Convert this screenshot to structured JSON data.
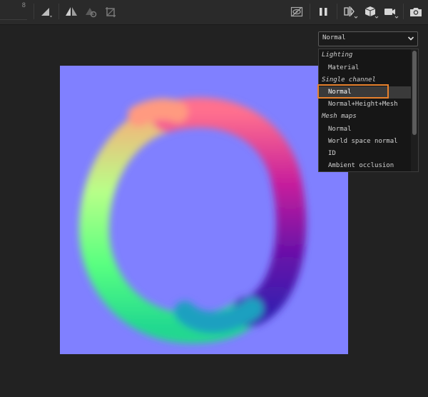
{
  "toolbar": {
    "partial_value": "8",
    "icons": [
      "slope-icon",
      "symmetry-icon",
      "lasso-icon",
      "transform-icon",
      "hide-icon",
      "pause-icon",
      "split-view-icon",
      "cube-icon",
      "camera-icon",
      "screenshot-icon"
    ]
  },
  "viewport_mode": {
    "selected": "Normal"
  },
  "menu": {
    "groups": [
      {
        "label": "Lighting",
        "items": [
          "Material"
        ]
      },
      {
        "label": "Single channel",
        "items": [
          "Normal",
          "Normal+Height+Mesh"
        ]
      },
      {
        "label": "Mesh maps",
        "items": [
          "Normal",
          "World space normal",
          "ID",
          "Ambient occlusion"
        ]
      }
    ],
    "highlighted": "Normal"
  },
  "colors": {
    "accent_outline": "#e7812d",
    "normal_base": "#8080ff",
    "background": "#222222"
  }
}
